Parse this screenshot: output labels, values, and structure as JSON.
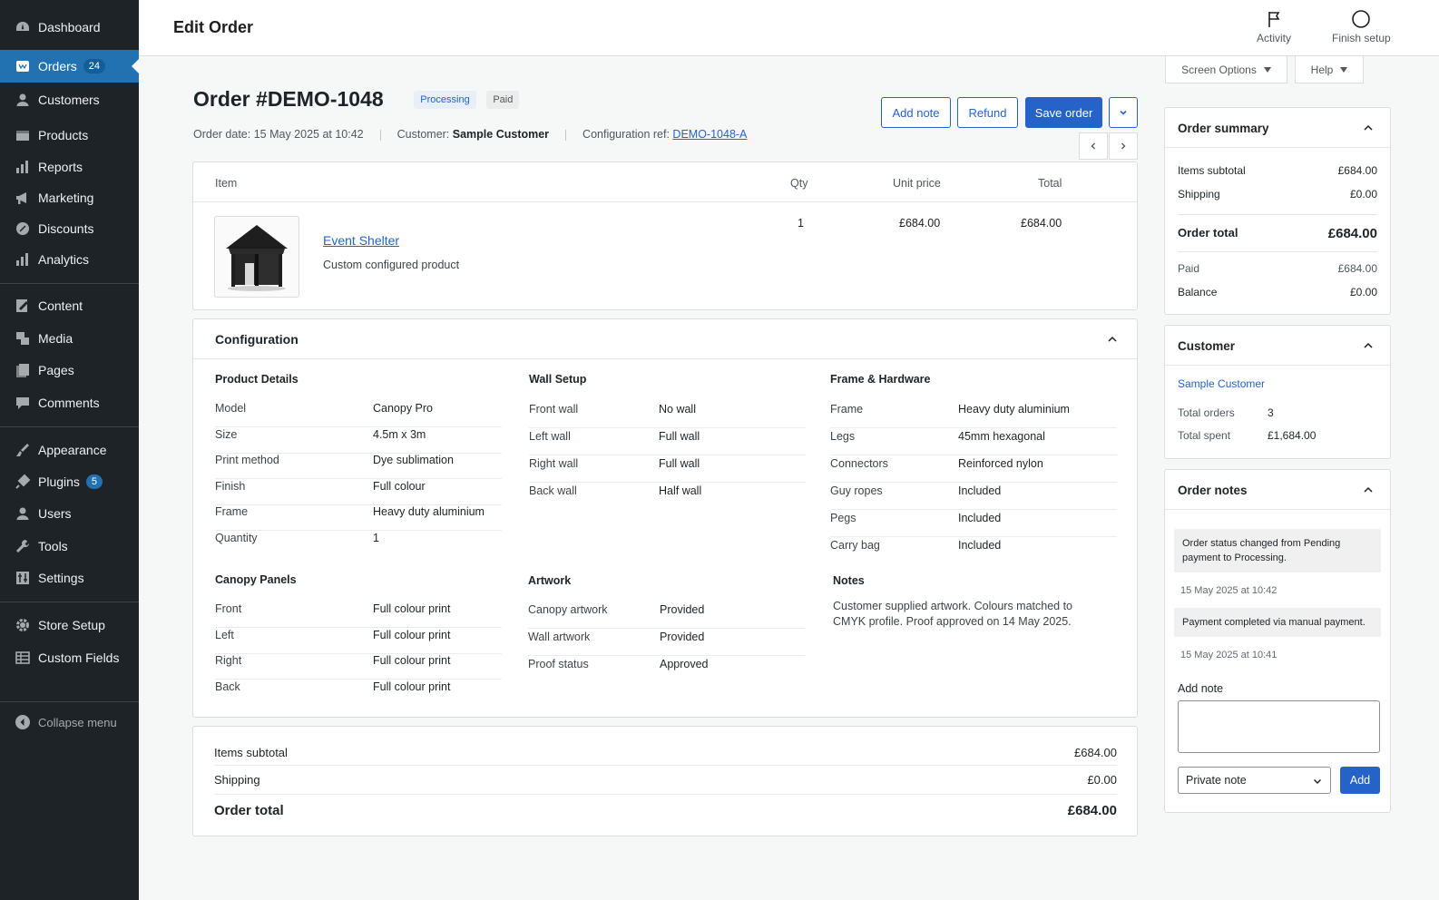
{
  "sidebar": {
    "items": [
      {
        "label": "Dashboard",
        "icon": "dashboard-icon"
      },
      {
        "label": "Orders",
        "badge": "24",
        "icon": "orders-icon"
      },
      {
        "label": "Customers",
        "icon": "customers-icon"
      },
      {
        "label": "Products",
        "icon": "products-icon"
      },
      {
        "label": "Reports",
        "icon": "reports-icon"
      },
      {
        "label": "Marketing",
        "icon": "megaphone-icon"
      },
      {
        "label": "Discounts",
        "icon": "discounts-icon"
      },
      {
        "label": "Analytics",
        "icon": "analytics-icon"
      },
      {
        "label": "Content",
        "icon": "content-icon"
      },
      {
        "label": "Media",
        "icon": "media-icon"
      },
      {
        "label": "Pages",
        "icon": "pages-icon"
      },
      {
        "label": "Comments",
        "icon": "comments-icon"
      },
      {
        "label": "Appearance",
        "icon": "appearance-icon"
      },
      {
        "label": "Plugins",
        "badge": "5",
        "icon": "plugins-icon"
      },
      {
        "label": "Users",
        "icon": "users-icon"
      },
      {
        "label": "Tools",
        "icon": "tools-icon"
      },
      {
        "label": "Settings",
        "icon": "settings-icon"
      },
      {
        "label": "Store Setup",
        "icon": "gear-icon"
      },
      {
        "label": "Custom Fields",
        "icon": "custom-fields-icon"
      }
    ],
    "collapse_label": "Collapse menu",
    "active_color": "#2271b1"
  },
  "topbar": {
    "title": "Edit Order",
    "activity_label": "Activity",
    "finish_setup_label": "Finish setup",
    "screen_options_label": "Screen Options",
    "help_label": "Help"
  },
  "order": {
    "title": "Order #DEMO-1048",
    "status_badge": "Processing",
    "payment_badge": "Paid",
    "date_text": "Order date: 15 May 2025 at 10:42",
    "customer_label": "Customer:",
    "customer_name": "Sample Customer",
    "config_ref_label": "Configuration ref:",
    "config_ref": "DEMO-1048-A"
  },
  "actions": {
    "add_note": "Add note",
    "refund": "Refund",
    "save_order": "Save order"
  },
  "items": {
    "headers": {
      "item": "Item",
      "qty": "Qty",
      "unit_price": "Unit price",
      "total": "Total"
    },
    "rows": [
      {
        "name": "Event Shelter",
        "subtitle": "Custom configured product",
        "qty": "1",
        "unit_price": "£684.00",
        "total": "£684.00"
      }
    ]
  },
  "configuration": {
    "title": "Configuration",
    "product_details": {
      "title": "Product Details",
      "rows": [
        {
          "k": "Model",
          "v": "Canopy Pro"
        },
        {
          "k": "Size",
          "v": "4.5m x 3m"
        },
        {
          "k": "Print method",
          "v": "Dye sublimation"
        },
        {
          "k": "Finish",
          "v": "Full colour"
        },
        {
          "k": "Frame",
          "v": "Heavy duty aluminium"
        },
        {
          "k": "Quantity",
          "v": "1"
        }
      ]
    },
    "wall_setup": {
      "title": "Wall Setup",
      "rows": [
        {
          "k": "Front wall",
          "v": "No wall"
        },
        {
          "k": "Left wall",
          "v": "Full wall"
        },
        {
          "k": "Right wall",
          "v": "Full wall"
        },
        {
          "k": "Back wall",
          "v": "Half wall"
        }
      ]
    },
    "frame_hardware": {
      "title": "Frame & Hardware",
      "rows": [
        {
          "k": "Frame",
          "v": "Heavy duty aluminium"
        },
        {
          "k": "Legs",
          "v": "45mm hexagonal"
        },
        {
          "k": "Connectors",
          "v": "Reinforced nylon"
        },
        {
          "k": "Guy ropes",
          "v": "Included"
        },
        {
          "k": "Pegs",
          "v": "Included"
        },
        {
          "k": "Carry bag",
          "v": "Included"
        }
      ]
    },
    "canopy_panels": {
      "title": "Canopy Panels",
      "rows": [
        {
          "k": "Front",
          "v": "Full colour print"
        },
        {
          "k": "Left",
          "v": "Full colour print"
        },
        {
          "k": "Right",
          "v": "Full colour print"
        },
        {
          "k": "Back",
          "v": "Full colour print"
        }
      ]
    },
    "artwork": {
      "title": "Artwork",
      "rows": [
        {
          "k": "Canopy artwork",
          "v": "Provided"
        },
        {
          "k": "Wall artwork",
          "v": "Provided"
        },
        {
          "k": "Proof status",
          "v": "Approved"
        }
      ]
    },
    "notes": {
      "title": "Notes",
      "text": "Customer supplied artwork. Colours matched to CMYK profile. Proof approved on 14 May 2025."
    }
  },
  "totals": {
    "subtotal_label": "Items subtotal",
    "subtotal": "£684.00",
    "shipping_label": "Shipping",
    "shipping": "£0.00",
    "total_label": "Order total",
    "total": "£684.00"
  },
  "summary": {
    "title": "Order summary",
    "items_subtotal_label": "Items subtotal",
    "items_subtotal": "£684.00",
    "shipping_label": "Shipping",
    "shipping": "£0.00",
    "order_total_label": "Order total",
    "order_total": "£684.00",
    "paid_label": "Paid",
    "paid": "£684.00",
    "balance_label": "Balance",
    "balance": "£0.00"
  },
  "customer": {
    "title": "Customer",
    "name": "Sample Customer",
    "total_orders_label": "Total orders",
    "total_orders": "3",
    "total_spent_label": "Total spent",
    "total_spent": "£1,684.00"
  },
  "order_notes": {
    "title": "Order notes",
    "notes": [
      {
        "text": "Order status changed from Pending payment to Processing.",
        "date": "15 May 2025 at 10:42"
      },
      {
        "text": "Payment completed via manual payment.",
        "date": "15 May 2025 at 10:41"
      }
    ],
    "add_note_label": "Add note",
    "note_type": "Private note",
    "add_button": "Add"
  }
}
